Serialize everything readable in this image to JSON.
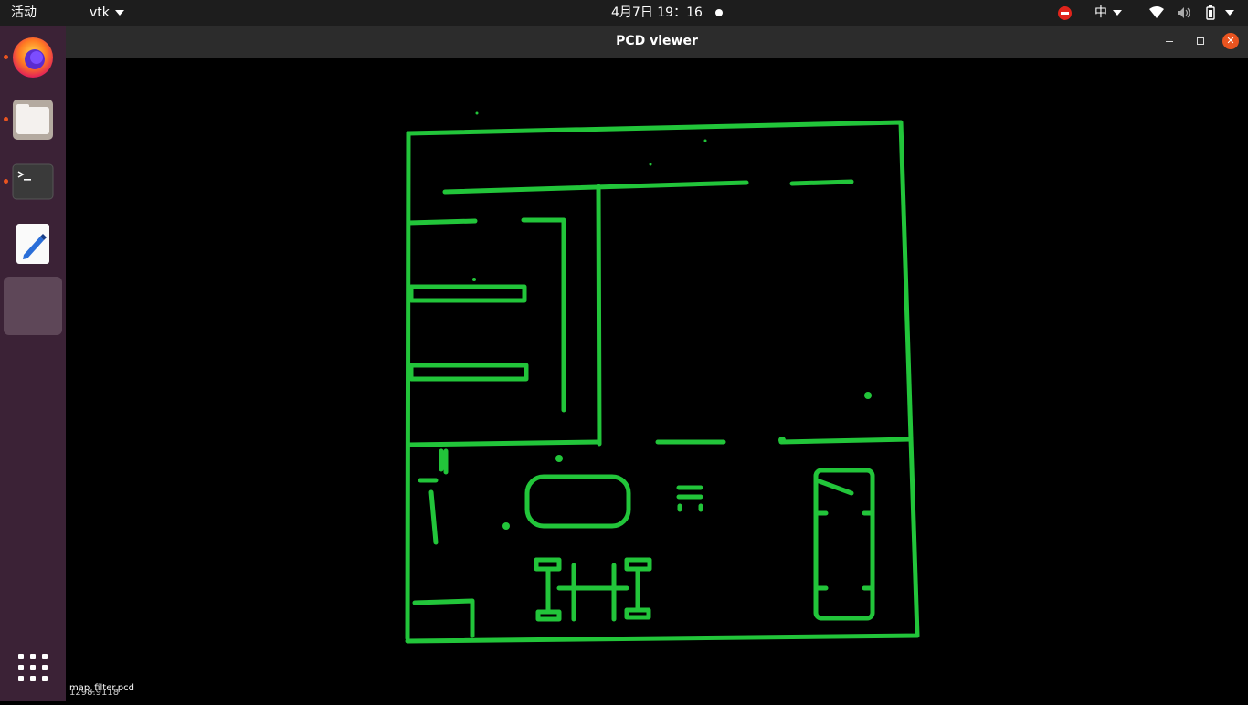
{
  "topbar": {
    "activities": "活动",
    "app_menu": "vtk",
    "clock": "4月7日  19：16",
    "input_method": "中"
  },
  "dock": {
    "items": [
      "Firefox",
      "Files",
      "Terminal",
      "Text Editor",
      "PCD viewer"
    ],
    "show_apps_icon": "grid-icon"
  },
  "window": {
    "title": "PCD viewer",
    "status_file": "map_filter.pcd",
    "status_coord": "1298.9118"
  },
  "colors": {
    "point_cloud": "#22c53a",
    "dock_bg": "#3b2236",
    "accent": "#e95420",
    "close_button": "#e95420"
  }
}
